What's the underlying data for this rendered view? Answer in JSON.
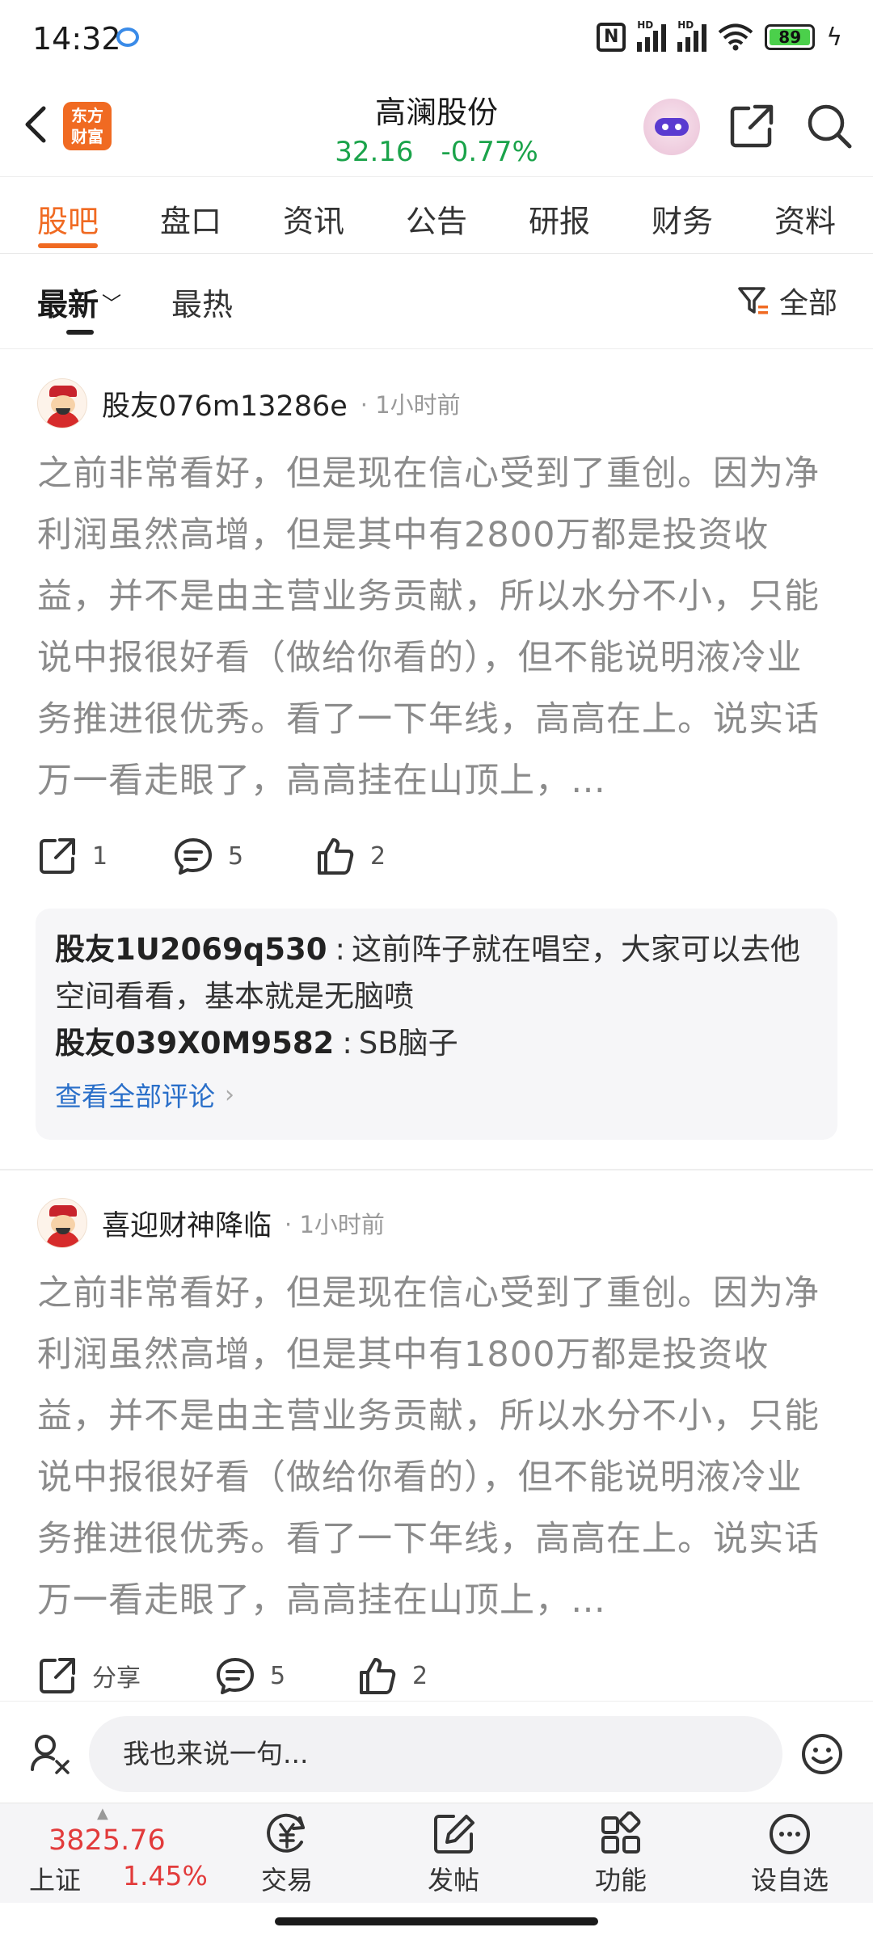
{
  "status_bar": {
    "time": "14:32",
    "battery": "89"
  },
  "header": {
    "logo_line1": "东方",
    "logo_line2": "财富",
    "stock_name": "高澜股份",
    "price": "32.16",
    "change_pct": "-0.77%"
  },
  "tabs": [
    {
      "label": "股吧",
      "active": true
    },
    {
      "label": "盘口"
    },
    {
      "label": "资讯"
    },
    {
      "label": "公告"
    },
    {
      "label": "研报"
    },
    {
      "label": "财务"
    },
    {
      "label": "资料"
    }
  ],
  "sort": {
    "latest": "最新",
    "hot": "最热",
    "filter": "全部"
  },
  "posts": [
    {
      "user": "股友076m13286e",
      "time": "1小时前",
      "body": "之前非常看好，但是现在信心受到了重创。因为净利润虽然高增，但是其中有2800万都是投资收益，并不是由主营业务贡献，所以水分不小，只能说中报很好看（做给你看的），但不能说明液冷业务推进很优秀。看了一下年线，高高在上。说实话万一看走眼了，高高挂在山顶上，…",
      "share": "1",
      "comments": "5",
      "likes": "2",
      "comment_list": [
        {
          "name": "股友1U2069q530",
          "text": "这前阵子就在唱空，大家可以去他空间看看，基本就是无脑喷"
        },
        {
          "name": "股友039X0M9582",
          "text": "SB脑子"
        }
      ],
      "view_all": "查看全部评论"
    },
    {
      "user": "喜迎财神降临",
      "time": "1小时前",
      "body": "之前非常看好，但是现在信心受到了重创。因为净利润虽然高增，但是其中有1800万都是投资收益，并不是由主营业务贡献，所以水分不小，只能说中报很好看（做给你看的），但不能说明液冷业务推进很优秀。看了一下年线，高高在上。说实话万一看走眼了，高高挂在山顶上，…",
      "share": "分享",
      "comments": "5",
      "likes": "2"
    }
  ],
  "input_bar": {
    "placeholder": "我也来说一句..."
  },
  "bottom_nav": {
    "index_value": "3825.76",
    "index_name": "上证",
    "index_pct": "1.45%",
    "items": [
      "交易",
      "发帖",
      "功能",
      "设自选"
    ]
  },
  "colors": {
    "accent": "#f06a22",
    "down": "#1aa34a",
    "up": "#e23b3b",
    "link": "#2a6fc9"
  }
}
